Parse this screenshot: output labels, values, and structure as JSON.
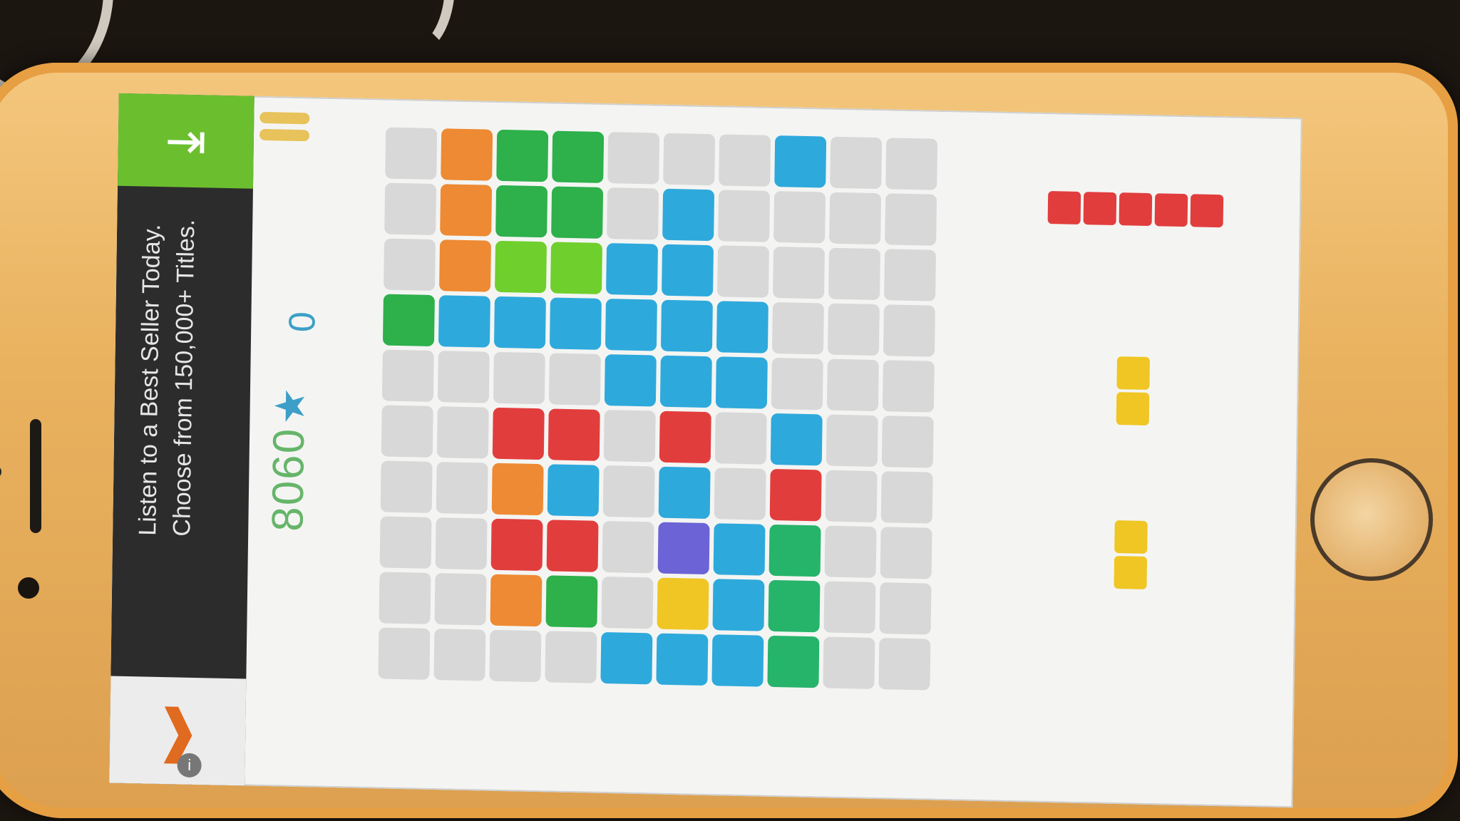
{
  "ad": {
    "line1": "Listen to a Best Seller Today.",
    "line2": "Choose from 150,000+ Titles.",
    "arrow_icon": "exit-arrow-icon",
    "logo_icon": "audible-logo-icon",
    "info_icon": "info-icon"
  },
  "scoreboard": {
    "score": "8060",
    "best_score": "0",
    "trophy_icon": "trophy-icon",
    "menu_icon": "pause-menu-icon"
  },
  "colors": {
    "empty": "#d8d8d8",
    "O": "#ee8a33",
    "G": "#2eb04b",
    "L": "#6fcf2c",
    "B": "#2ea9dc",
    "R": "#e23d3d",
    "Y": "#f0c624",
    "P": "#6c63d6",
    "T": "#26b46a"
  },
  "board": {
    "columns": 10,
    "rows": [
      ".OGG...B..",
      ".OGG.B....",
      ".OLLBB....",
      "GBBBBBB...",
      "....BBB...",
      "..RR.R.B..",
      "..OB.B.R..",
      "..RR.PBT..",
      "..OG.YBT..",
      "....BBBT.."
    ]
  },
  "tray": {
    "pieces": [
      {
        "color": "R",
        "cols": 5,
        "rows": 1
      },
      {
        "color": "Y",
        "cols": 1,
        "rows": 2
      },
      {
        "color": "Y",
        "cols": 1,
        "rows": 2
      }
    ]
  }
}
